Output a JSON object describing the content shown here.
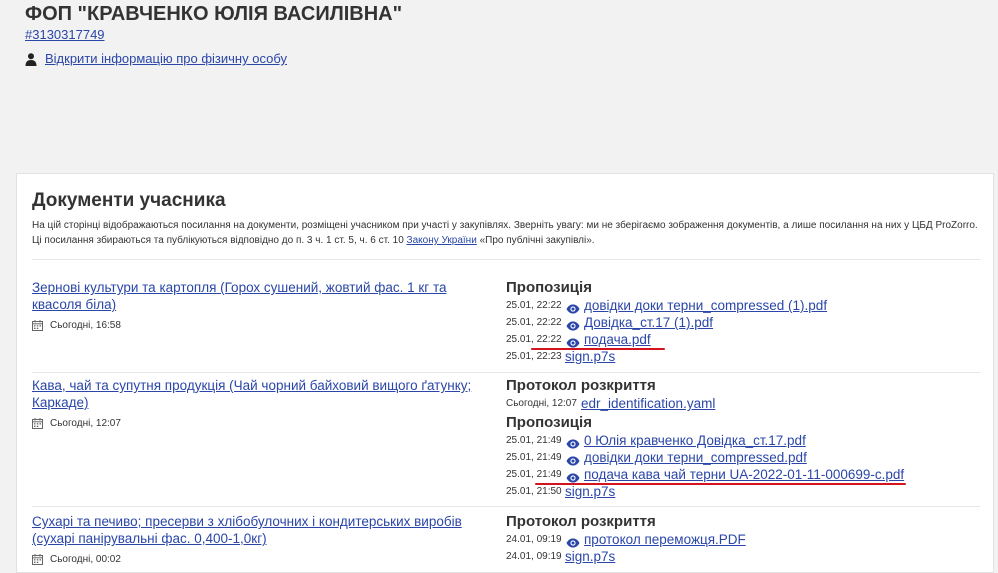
{
  "header": {
    "company_name": "ФОП \"КРАВЧЕНКО ЮЛІЯ ВАСИЛІВНА\"",
    "edrpou": "#3130317749",
    "person_link": "Відкрити інформацію про фізичну особу"
  },
  "card": {
    "title": "Документи учасника",
    "notice_text": "На цій сторінці відображаються посилання на документи, розміщені учасником при участі у закупівлях. Зверніть увагу: ми не зберігаємо зображення документів, а лише посилання на них у ЦБД ProZorro. Ці посилання збираються та публікуються відповідно до п. 3 ч. 1 ст. 5, ч. 6 ст. 10 ",
    "notice_link": "Закону України",
    "notice_tail": " «Про публічні закупівлі»."
  },
  "tenders": [
    {
      "title": "Зернові культури та картопля (Горох сушений, жовтий фас. 1 кг та квасоля біла)",
      "date": "Сьогодні, 16:58",
      "groups": [
        {
          "title": "Пропозиція",
          "docs": [
            {
              "time": "25.01, 22:22",
              "name": "довідки доки терни_compressed (1).pdf",
              "eye": true
            },
            {
              "time": "25.01, 22:22",
              "name": "Довідка_ст.17 (1).pdf",
              "eye": true
            },
            {
              "time": "25.01, 22:22",
              "name": "подача.pdf",
              "eye": true
            },
            {
              "time": "25.01, 22:23",
              "name": "sign.p7s",
              "eye": false
            }
          ]
        }
      ]
    },
    {
      "title": "Кава, чай та супутня продукція (Чай чорний байховий вищого ґатунку; Каркаде)",
      "date": "Сьогодні, 12:07",
      "groups": [
        {
          "title": "Протокол розкриття",
          "docs": [
            {
              "time": "Сьогодні, 12:07",
              "name": "edr_identification.yaml",
              "eye": false
            }
          ]
        },
        {
          "title": "Пропозиція",
          "docs": [
            {
              "time": "25.01, 21:49",
              "name": "0 Юлія кравченко Довідка_ст.17.pdf",
              "eye": true
            },
            {
              "time": "25.01, 21:49",
              "name": "довідки доки терни_compressed.pdf",
              "eye": true
            },
            {
              "time": "25.01, 21:49",
              "name": "подача кава чай терни UA-2022-01-11-000699-c.pdf",
              "eye": true
            },
            {
              "time": "25.01, 21:50",
              "name": "sign.p7s",
              "eye": false
            }
          ]
        }
      ]
    },
    {
      "title": "Сухарі та печиво; пресерви з хлібобулочних і кондитерських виробів (сухарі панірувальні фас. 0,400-1,0кг)",
      "date": "Сьогодні, 00:02",
      "groups": [
        {
          "title": "Протокол розкриття",
          "docs": [
            {
              "time": "24.01, 09:19",
              "name": "протокол переможця.PDF",
              "eye": true
            },
            {
              "time": "24.01, 09:19",
              "name": "sign.p7s",
              "eye": false
            }
          ]
        }
      ]
    }
  ],
  "colors": {
    "link": "#2a46a8",
    "annotation": "#d2141e",
    "page_bg": "#f2f2f2"
  }
}
